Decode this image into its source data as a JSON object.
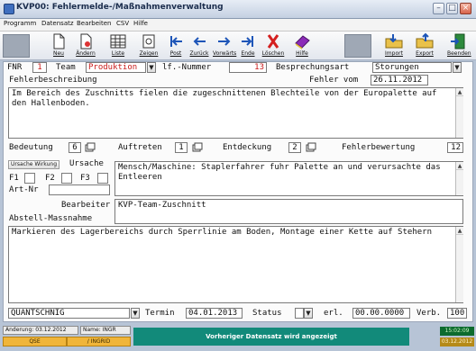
{
  "window": {
    "title": "KVP00: Fehlermelde-/Maßnahmenverwaltung"
  },
  "menu": [
    "Programm",
    "Datensatz",
    "Bearbeiten",
    "CSV",
    "Hilfe"
  ],
  "toolbar": {
    "neu": "Neu",
    "aendern": "Ändern",
    "liste": "Liste",
    "zeigen": "Zeigen",
    "post": "Post",
    "zurueck": "Zurück",
    "vorwaerts": "Vorwärts",
    "ende": "Ende",
    "loeschen": "Löschen",
    "hilfe": "Hilfe",
    "import": "Import",
    "export": "Export",
    "beenden": "Beenden"
  },
  "form": {
    "fnr_label": "FNR",
    "fnr_value": "1",
    "team_label": "Team",
    "team_value": "Produktion",
    "lfnr_label": "lf.-Nummer",
    "lfnr_value": "13",
    "besprechung_label": "Besprechungsart",
    "besprechung_value": "Storungen",
    "fehlerbeschreibung_label": "Fehlerbeschreibung",
    "fehler_vom_label": "Fehler vom",
    "fehler_vom_value": "26.11.2012",
    "fehlerbeschreibung_text": "Im Bereich des Zuschnitts fielen die zugeschnittenen Blechteile von der Europalette auf den Hallenboden.",
    "bedeutung_label": "Bedeutung",
    "bedeutung_value": "6",
    "auftreten_label": "Auftreten",
    "auftreten_value": "1",
    "entdeckung_label": "Entdeckung",
    "entdeckung_value": "2",
    "fehlerbewertung_label": "Fehlerbewertung",
    "fehlerbewertung_value": "12",
    "ursache_wirkung_btn": "Ursache Wirkung",
    "ursache_label": "Ursache",
    "ursache_text": "Mensch/Maschine: Staplerfahrer fuhr Palette an und verursachte das Entleeren",
    "f1_label": "F1",
    "f2_label": "F2",
    "f3_label": "F3",
    "artnr_label": "Art-Nr",
    "bearbeiter_label": "Bearbeiter",
    "bearbeiter_value": "KVP-Team-Zuschnitt",
    "abstell_label": "Abstell-Massnahme",
    "abstell_text": "Markieren des Lagerbereichs durch Sperrlinie am Boden, Montage einer Kette auf Stehern",
    "verantwortlich_value": "QUANTSCHNIG",
    "termin_label": "Termin",
    "termin_value": "04.01.2013",
    "status_label": "Status",
    "erl_label": "erl.",
    "erl_value": "00.00.0000",
    "verb_label": "Verb.",
    "verb_value": "100"
  },
  "statusbar": {
    "aenderung": "Anderung: 03.12.2012",
    "name": "Name: INGR",
    "qse": "QSE",
    "ingrid": "/ INGRID",
    "message": "Vorheriger Datensatz wird angezeigt",
    "clock": "15:02:09",
    "date": "03.12.2012"
  },
  "colors": {
    "accent_red": "#c91a1a",
    "status_teal": "#128a7a",
    "status_orange": "#f0b53a"
  }
}
